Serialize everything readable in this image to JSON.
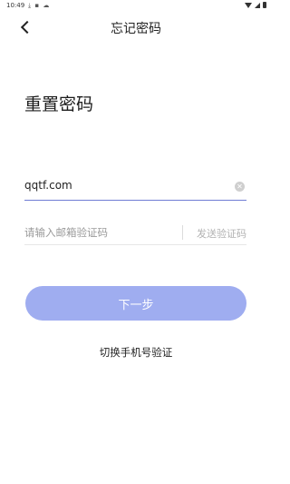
{
  "status_bar": {
    "time": "10:49",
    "left_icons": [
      "download-icon",
      "notification-icon",
      "cloud-icon"
    ],
    "right_icons": [
      "wifi-icon",
      "signal-icon",
      "battery-icon"
    ]
  },
  "header": {
    "back_icon": "chevron-left-icon",
    "title": "忘记密码"
  },
  "page": {
    "heading": "重置密码"
  },
  "email": {
    "value": "qqtf.com",
    "clear_icon": "clear-icon",
    "accent_color": "#6f7dd4"
  },
  "code": {
    "placeholder": "请输入邮箱验证码",
    "send_label": "发送验证码"
  },
  "actions": {
    "next_label": "下一步",
    "next_color": "#9fadf0",
    "switch_label": "切换手机号验证"
  }
}
